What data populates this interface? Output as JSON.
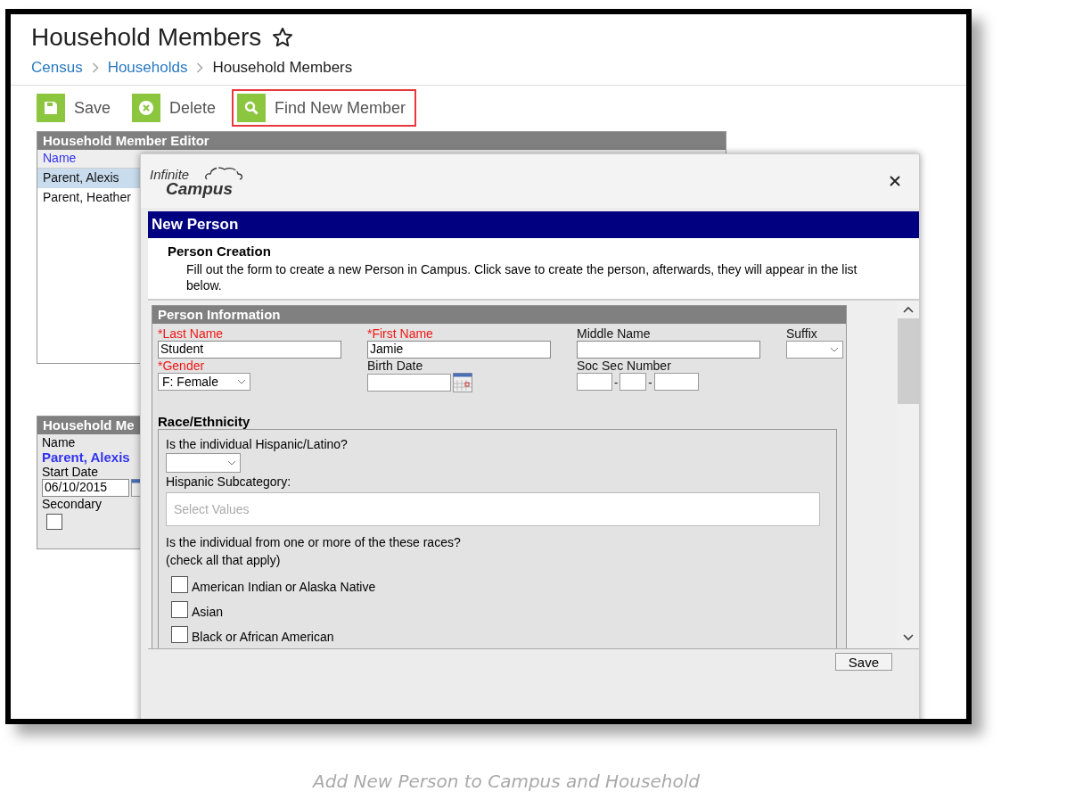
{
  "page": {
    "title": "Household Members",
    "breadcrumb": [
      {
        "label": "Census",
        "link": true
      },
      {
        "label": "Households",
        "link": true
      },
      {
        "label": "Household Members",
        "link": false
      }
    ]
  },
  "toolbar": [
    {
      "label": "Save",
      "kind": "save",
      "highlighted": false
    },
    {
      "label": "Delete",
      "kind": "delete",
      "highlighted": false
    },
    {
      "label": "Find New Member",
      "kind": "find",
      "highlighted": true
    }
  ],
  "editor": {
    "title": "Household Member Editor",
    "column": "Name",
    "rows": [
      {
        "name": "Parent, Alexis",
        "selected": true
      },
      {
        "name": "Parent, Heather",
        "selected": false
      }
    ]
  },
  "detail": {
    "title": "Household Me",
    "name_label": "Name",
    "name": "Parent, Alexis",
    "start_date_label": "Start Date",
    "start_date": "06/10/2015",
    "secondary_label": "Secondary",
    "secondary": false
  },
  "dialog": {
    "logo_top": "Infinite",
    "logo_bottom": "Campus",
    "title": "New Person",
    "section": "Person Creation",
    "description": "Fill out the form to create a new Person in Campus. Click save to create the person, afterwards, they will appear in the list below.",
    "panel_title": "Person Information",
    "fields": [
      {
        "label": "*Last Name",
        "required": true,
        "kind": "text",
        "value": "Student"
      },
      {
        "label": "*First Name",
        "required": true,
        "kind": "text",
        "value": "Jamie"
      },
      {
        "label": "Middle Name",
        "required": false,
        "kind": "text"
      },
      {
        "label": "Suffix",
        "required": false,
        "kind": "select"
      },
      {
        "label": "*Gender",
        "required": true,
        "kind": "select",
        "value": "F: Female"
      },
      {
        "label": "Birth Date",
        "required": false,
        "kind": "date"
      },
      {
        "label": "Soc Sec Number",
        "required": false,
        "kind": "ssn",
        "separators": [
          "-",
          "-"
        ]
      }
    ],
    "race_title": "Race/Ethnicity",
    "hispanic_question": "Is the individual Hispanic/Latino?",
    "subcategory_label": "Hispanic Subcategory:",
    "subcategory_placeholder": "Select Values",
    "races_question": "Is the individual from one or more of the these races?",
    "races_hint": "(check all that apply)",
    "races": [
      {
        "label": "American Indian or Alaska Native",
        "checked": false
      },
      {
        "label": "Asian",
        "checked": false
      },
      {
        "label": "Black or African American",
        "checked": false
      }
    ],
    "save": "Save"
  },
  "caption": "Add New Person to Campus and Household"
}
